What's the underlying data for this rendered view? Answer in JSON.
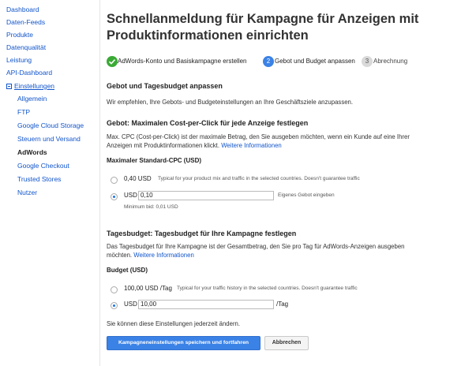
{
  "sidebar": {
    "items": [
      {
        "label": "Dashboard"
      },
      {
        "label": "Daten-Feeds"
      },
      {
        "label": "Produkte"
      },
      {
        "label": "Datenqualität"
      },
      {
        "label": "Leistung"
      },
      {
        "label": "API-Dashboard"
      },
      {
        "label": "Einstellungen"
      },
      {
        "label": "Allgemein"
      },
      {
        "label": "FTP"
      },
      {
        "label": "Google Cloud Storage"
      },
      {
        "label": "Steuern und Versand"
      },
      {
        "label": "AdWords"
      },
      {
        "label": "Google Checkout"
      },
      {
        "label": "Trusted Stores"
      },
      {
        "label": "Nutzer"
      }
    ]
  },
  "main": {
    "title": "Schnellanmeldung für Kampagne für Anzeigen mit Produktinformationen einrichten",
    "steps": [
      {
        "number": "",
        "label": "AdWords-Konto und Basiskampagne erstellen",
        "state": "done"
      },
      {
        "number": "2",
        "label": "Gebot und Budget anpassen",
        "state": "current"
      },
      {
        "number": "3",
        "label": "Abrechnung",
        "state": "upcoming"
      }
    ],
    "section_heading": "Gebot und Tagesbudget anpassen",
    "section_intro": "Wir empfehlen, Ihre Gebots- und Budgeteinstellungen an Ihre Geschäftsziele anzupassen.",
    "bid": {
      "heading": "Gebot: Maximalen Cost-per-Click für jede Anzeige festlegen",
      "description": "Max. CPC (Cost-per-Click) ist der maximale Betrag, den Sie ausgeben möchten, wenn ein Kunde auf eine Ihrer Anzeigen mit Produktinformationen klickt.",
      "more_link": "Weitere Informationen",
      "field_label": "Maximaler Standard-CPC (USD)",
      "option1_value": "0,40 USD",
      "option1_note": "Typical for your product mix and traffic in the selected countries. Doesn't guarantee traffic",
      "option2_prefix": "USD",
      "option2_value": "0,10",
      "option2_note": "Eigenes Gebot eingeben",
      "min_bid": "Minimum bid: 0,01 USD"
    },
    "budget": {
      "heading": "Tagesbudget: Tagesbudget für Ihre Kampagne festlegen",
      "description": "Das Tagesbudget für Ihre Kampagne ist der Gesamtbetrag, den Sie pro Tag für AdWords-Anzeigen ausgeben möchten.",
      "more_link": "Weitere Informationen",
      "field_label": "Budget (USD)",
      "option1_value": "100,00 USD /Tag",
      "option1_note": "Typical for your traffic history in the selected countries. Doesn't guarantee traffic",
      "option2_prefix": "USD",
      "option2_value": "10,00",
      "option2_suffix": "/Tag"
    },
    "change_note": "Sie können diese Einstellungen jederzeit ändern.",
    "save_button": "Kampagneneinstellungen speichern und fortfahren",
    "cancel_button": "Abbrechen"
  },
  "colors": {
    "link": "#1155cc",
    "step_done": "#3aaa35",
    "step_current": "#3b82e6",
    "step_upcoming": "#d9d9d9",
    "primary_button": "#3b82e6"
  }
}
